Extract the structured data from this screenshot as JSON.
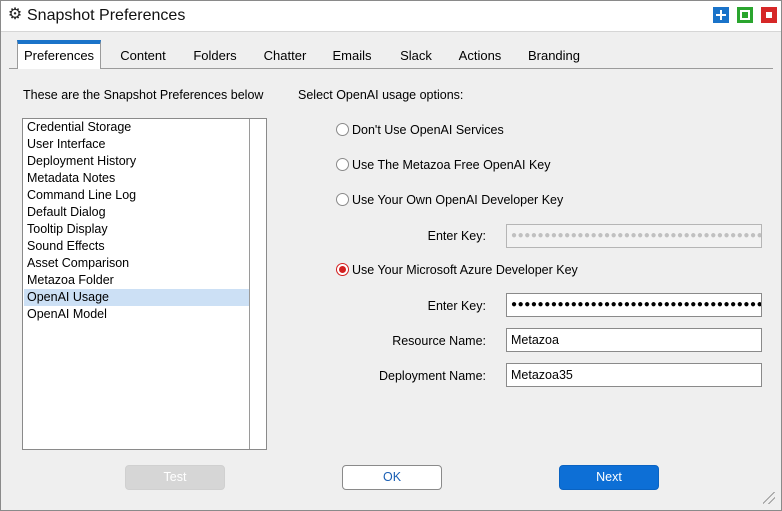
{
  "window": {
    "title": "Snapshot Preferences",
    "icon": "gear-icon"
  },
  "window_buttons": [
    {
      "name": "add-button",
      "icon": "plus-icon",
      "color": "#1a73c9"
    },
    {
      "name": "maximize-button",
      "icon": "square-icon",
      "color": "#2aa52e"
    },
    {
      "name": "close-button",
      "icon": "stop-icon",
      "color": "#d62828"
    }
  ],
  "tabs": [
    {
      "label": "Preferences",
      "active": true
    },
    {
      "label": "Content"
    },
    {
      "label": "Folders"
    },
    {
      "label": "Chatter"
    },
    {
      "label": "Emails"
    },
    {
      "label": "Slack"
    },
    {
      "label": "Actions"
    },
    {
      "label": "Branding"
    }
  ],
  "left": {
    "heading": "These are the Snapshot Preferences below",
    "items": [
      "Credential Storage",
      "User Interface",
      "Deployment History",
      "Metadata Notes",
      "Command Line Log",
      "Default Dialog",
      "Tooltip Display",
      "Sound Effects",
      "Asset Comparison",
      "Metazoa Folder",
      "OpenAI Usage",
      "OpenAI Model"
    ],
    "selected": "OpenAI Usage"
  },
  "right": {
    "heading": "Select OpenAI usage options:",
    "options": [
      {
        "label": "Don't Use OpenAI Services",
        "selected": false
      },
      {
        "label": "Use The Metazoa Free OpenAI Key",
        "selected": false
      },
      {
        "label": "Use Your Own OpenAI Developer Key",
        "selected": false
      },
      {
        "label": "Use Your Microsoft Azure Developer Key",
        "selected": true
      }
    ],
    "own_key": {
      "label": "Enter Key:",
      "value": "●●●●●●●●●●●●●●●●●●●●●●●●●●●●●●●●●●●●●●"
    },
    "azure_key": {
      "label": "Enter Key:",
      "value": "●●●●●●●●●●●●●●●●●●●●●●●●●●●●●●●●●●●●●●"
    },
    "resource": {
      "label": "Resource Name:",
      "value": "Metazoa"
    },
    "deployment": {
      "label": "Deployment Name:",
      "value": "Metazoa35"
    }
  },
  "buttons": {
    "test": "Test",
    "ok": "OK",
    "next": "Next"
  },
  "colors": {
    "accent": "#1a73c9",
    "selected_radio": "#d32020",
    "primary_button": "#0d6fd6",
    "list_selection": "#cce0f5"
  }
}
